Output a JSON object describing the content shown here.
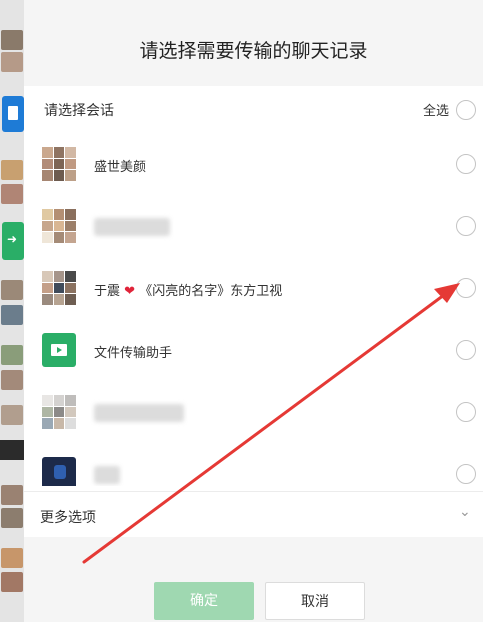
{
  "dialog": {
    "title": "请选择需要传输的聊天记录",
    "select_label": "请选择会话",
    "select_all_label": "全选",
    "more_options_label": "更多选项",
    "confirm_label": "确定",
    "cancel_label": "取消"
  },
  "conversations": [
    {
      "name": "盛世美颜",
      "type": "group"
    },
    {
      "name": "",
      "type": "group-blurred"
    },
    {
      "name_prefix": "于震",
      "name_suffix": "《闪亮的名字》东方卫视",
      "type": "group"
    },
    {
      "name": "文件传输助手",
      "type": "file-transfer"
    },
    {
      "name": "",
      "type": "group-blurred"
    },
    {
      "name": "",
      "type": "single-blurred"
    }
  ],
  "colors": {
    "accent_green": "#2aae67",
    "confirm_disabled": "#9fd8b1",
    "annotation_arrow": "#e53935"
  }
}
